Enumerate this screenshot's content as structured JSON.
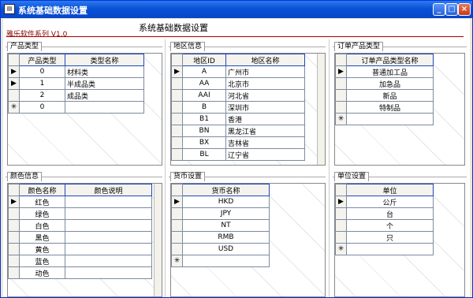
{
  "window": {
    "title": "系统基础数据设置",
    "header_title": "系统基础数据设置",
    "brand": "雅乐软件系列 V1.0"
  },
  "product_type": {
    "label": "产品类型",
    "columns": [
      "产品类型",
      "类型名称"
    ],
    "rows": [
      [
        "0",
        "材料类"
      ],
      [
        "1",
        "半成品类"
      ],
      [
        "2",
        "成品类"
      ]
    ],
    "new_row": [
      "0",
      ""
    ]
  },
  "region": {
    "label": "地区信息",
    "columns": [
      "地区ID",
      "地区名称"
    ],
    "rows": [
      [
        "A",
        "广州市"
      ],
      [
        "AA",
        "北京市"
      ],
      [
        "AAI",
        "河北省"
      ],
      [
        "B",
        "深圳市"
      ],
      [
        "B1",
        "香港"
      ],
      [
        "BN",
        "黑龙江省"
      ],
      [
        "BX",
        "吉林省"
      ],
      [
        "BL",
        "辽宁省"
      ]
    ]
  },
  "order_product_type": {
    "label": "订单产品类型",
    "columns": [
      "订单产品类型名称"
    ],
    "rows": [
      [
        "普通加工品"
      ],
      [
        "加急品"
      ],
      [
        "新品"
      ],
      [
        "特制品"
      ]
    ]
  },
  "color": {
    "label": "颜色信息",
    "columns": [
      "颜色名称",
      "颜色说明"
    ],
    "rows": [
      [
        "红色",
        ""
      ],
      [
        "绿色",
        ""
      ],
      [
        "白色",
        ""
      ],
      [
        "黑色",
        ""
      ],
      [
        "黄色",
        ""
      ],
      [
        "蓝色",
        ""
      ],
      [
        "动色",
        ""
      ]
    ]
  },
  "currency": {
    "label": "货币设置",
    "columns": [
      "货币名称"
    ],
    "rows": [
      [
        "HKD"
      ],
      [
        "JPY"
      ],
      [
        "NT"
      ],
      [
        "RMB"
      ],
      [
        "USD"
      ]
    ]
  },
  "unit": {
    "label": "单位设置",
    "columns": [
      "单位"
    ],
    "rows": [
      [
        "公斤"
      ],
      [
        "台"
      ],
      [
        "个"
      ],
      [
        "只"
      ]
    ]
  },
  "icons": {
    "current_row": "row-pointer-icon",
    "new_row": "new-row-asterisk-icon"
  }
}
